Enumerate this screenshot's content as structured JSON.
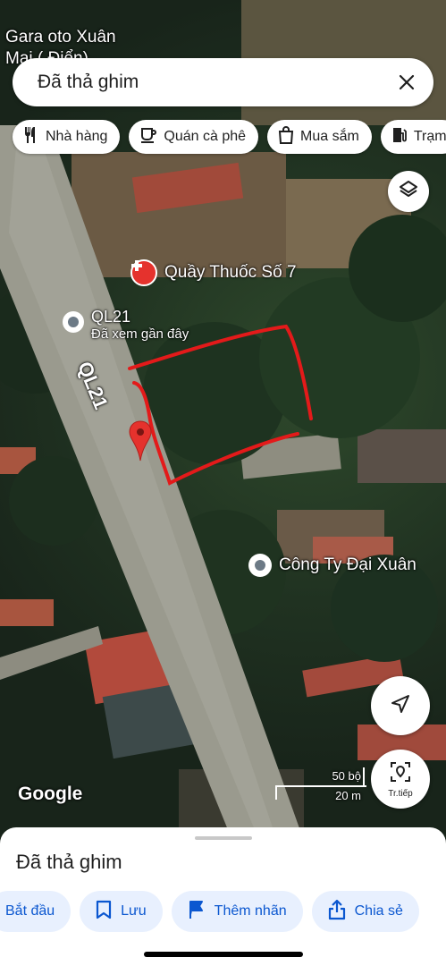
{
  "map": {
    "top_label": "Gara oto Xuân Mai ( Điển)",
    "road_label": "QL21",
    "places": [
      {
        "name": "Quầy Thuốc Số 7",
        "subtitle": "",
        "icon": "pharmacy-pin-icon"
      },
      {
        "name": "QL21",
        "subtitle": "Đã xem gần đây",
        "icon": "recent-pin-icon"
      },
      {
        "name": "Công Ty Đại Xuân",
        "subtitle": "",
        "icon": "place-pin-icon"
      }
    ],
    "google_logo": "Google",
    "scale": {
      "imperial": "50 bộ",
      "metric": "20 m"
    },
    "accent_red": "#e5322d",
    "annotation_color": "#e31a1a"
  },
  "search": {
    "query": "Đã thả ghim",
    "clear_icon": "close-icon"
  },
  "chips": [
    {
      "label": "Nhà hàng",
      "icon": "restaurant-icon"
    },
    {
      "label": "Quán cà phê",
      "icon": "coffee-icon"
    },
    {
      "label": "Mua sắm",
      "icon": "shopping-bag-icon"
    },
    {
      "label": "Trạm",
      "icon": "gas-station-icon"
    }
  ],
  "controls": {
    "layers_icon": "layers-icon",
    "locate_icon": "navigation-arrow-icon",
    "live_view_label": "Tr.tiếp"
  },
  "sheet": {
    "title": "Đã thả ghim",
    "actions": [
      {
        "label": "Bắt đầu",
        "icon": "navigation-icon"
      },
      {
        "label": "Lưu",
        "icon": "bookmark-icon"
      },
      {
        "label": "Thêm nhãn",
        "icon": "flag-icon"
      },
      {
        "label": "Chia sẻ",
        "icon": "share-icon"
      }
    ]
  }
}
